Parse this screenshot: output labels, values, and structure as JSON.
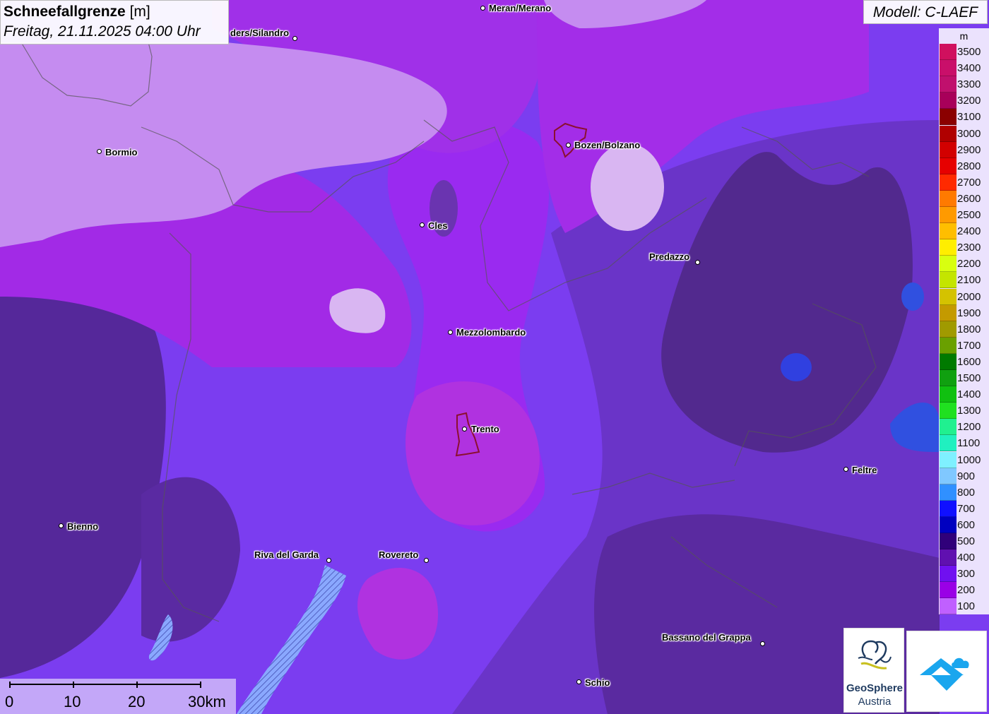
{
  "title": {
    "variable": "Schneefallgrenze",
    "unit": "[m]",
    "datetime": "Freitag, 21.11.2025 04:00 Uhr"
  },
  "model": "Modell: C-LAEF",
  "legend": {
    "unit": "m",
    "levels": [
      {
        "label": "3500",
        "color": "#d0105e"
      },
      {
        "label": "3400",
        "color": "#c90f6a"
      },
      {
        "label": "3300",
        "color": "#c0106d"
      },
      {
        "label": "3200",
        "color": "#a8005a"
      },
      {
        "label": "3100",
        "color": "#8b0000"
      },
      {
        "label": "3000",
        "color": "#b00000"
      },
      {
        "label": "2900",
        "color": "#d20000"
      },
      {
        "label": "2800",
        "color": "#e60000"
      },
      {
        "label": "2700",
        "color": "#ff2a00"
      },
      {
        "label": "2600",
        "color": "#ff7a00"
      },
      {
        "label": "2500",
        "color": "#ff9a00"
      },
      {
        "label": "2400",
        "color": "#ffbe00"
      },
      {
        "label": "2300",
        "color": "#ffee00"
      },
      {
        "label": "2200",
        "color": "#d8ff10"
      },
      {
        "label": "2100",
        "color": "#c4e500"
      },
      {
        "label": "2000",
        "color": "#d4c200"
      },
      {
        "label": "1900",
        "color": "#c49a00"
      },
      {
        "label": "1800",
        "color": "#a09a00"
      },
      {
        "label": "1700",
        "color": "#6aa000"
      },
      {
        "label": "1600",
        "color": "#007a00"
      },
      {
        "label": "1500",
        "color": "#10a010"
      },
      {
        "label": "1400",
        "color": "#10c010"
      },
      {
        "label": "1300",
        "color": "#20e020"
      },
      {
        "label": "1200",
        "color": "#20f090"
      },
      {
        "label": "1100",
        "color": "#20f0c0"
      },
      {
        "label": "1000",
        "color": "#7ff0ff"
      },
      {
        "label": "900",
        "color": "#80c8ff"
      },
      {
        "label": "800",
        "color": "#3090ff"
      },
      {
        "label": "700",
        "color": "#1010ff"
      },
      {
        "label": "600",
        "color": "#0000c0"
      },
      {
        "label": "500",
        "color": "#30007a"
      },
      {
        "label": "400",
        "color": "#6010b0"
      },
      {
        "label": "300",
        "color": "#7010f0"
      },
      {
        "label": "200",
        "color": "#9a00e6"
      },
      {
        "label": "100",
        "color": "#c060ff"
      }
    ]
  },
  "scale": {
    "labels": [
      "0",
      "10",
      "20",
      "30km"
    ]
  },
  "cities": [
    {
      "name": "Meran/Merano",
      "id": "meran"
    },
    {
      "name": "ders/Silandro",
      "id": "silandro"
    },
    {
      "name": "Bormio",
      "id": "bormio"
    },
    {
      "name": "Bozen/Bolzano",
      "id": "bozen"
    },
    {
      "name": "Cles",
      "id": "cles"
    },
    {
      "name": "Predazzo",
      "id": "predazzo"
    },
    {
      "name": "Mezzolombardo",
      "id": "mezzolombardo"
    },
    {
      "name": "Trento",
      "id": "trento"
    },
    {
      "name": "Feltre",
      "id": "feltre"
    },
    {
      "name": "Bienno",
      "id": "bienno"
    },
    {
      "name": "Riva del Garda",
      "id": "riva"
    },
    {
      "name": "Rovereto",
      "id": "rovereto"
    },
    {
      "name": "Bassano del Grappa",
      "id": "bassano"
    },
    {
      "name": "Schio",
      "id": "schio"
    }
  ],
  "logos": {
    "geosphere_line1": "GeoSphere",
    "geosphere_line2": "Austria"
  }
}
